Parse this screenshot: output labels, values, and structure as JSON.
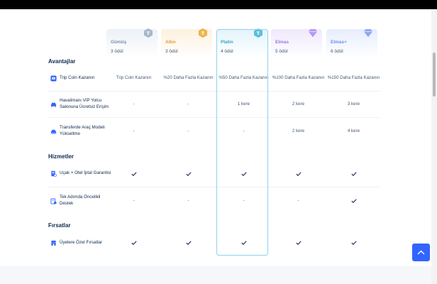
{
  "colors": {
    "accent": "#3264ff",
    "platin_border": "#8fd0ee",
    "text": "#0f294d",
    "muted": "#455873"
  },
  "tiers": [
    {
      "name": "Gümüş",
      "count": "3 ödül",
      "badge": "silver-badge-icon",
      "color": "#7c90a8"
    },
    {
      "name": "Altın",
      "count": "3 ödül",
      "badge": "gold-badge-icon",
      "color": "#e39a2c"
    },
    {
      "name": "Platin",
      "count": "4 ödül",
      "badge": "platinum-badge-icon",
      "color": "#34a6c7"
    },
    {
      "name": "Elmas",
      "count": "5 ödül",
      "badge": "diamond-badge-icon",
      "color": "#9a74ea"
    },
    {
      "name": "Elmas+",
      "count": "6 ödül",
      "badge": "diamond-plus-badge-icon",
      "color": "#6f8ff2"
    }
  ],
  "sections": {
    "advantages": "Avantajlar",
    "services": "Hizmetler",
    "deals": "Fırsatlar"
  },
  "rows": [
    {
      "label": "Trip Coin Kazanın",
      "icon": "trip-coin-icon",
      "cells": [
        "Trip Coin Kazanın",
        "%20 Daha Fazla Kazanın",
        "%50 Daha Fazla Kazanın",
        "%100 Daha Fazla Kazanın",
        "%150 Daha Fazla Kazanın"
      ]
    },
    {
      "label": "Havalimanı VIP Yolcu Salonuna Ücretsiz Erişim",
      "icon": "vip-lounge-icon",
      "cells": [
        "-",
        "-",
        "1 kere",
        "2 kere",
        "3 kere"
      ]
    },
    {
      "label": "Transferde Araç Modeli Yükseltme",
      "icon": "car-upgrade-icon",
      "cells": [
        "-",
        "-",
        "-",
        "2 kere",
        "4 kere"
      ]
    },
    {
      "label": "Uçak + Otel İptal Garantisi",
      "icon": "cancellation-guarantee-icon",
      "cells": [
        "check",
        "check",
        "check",
        "check",
        "check"
      ]
    },
    {
      "label": "Tek Adımda Öncelikli Destek",
      "icon": "priority-support-icon",
      "cells": [
        "-",
        "-",
        "-",
        "-",
        "check"
      ]
    },
    {
      "label": "Üyelere Özel Fırsatlar",
      "icon": "member-deals-icon",
      "cells": [
        "check",
        "check",
        "check",
        "check",
        "check"
      ]
    }
  ],
  "scroll_to_top_icon": "chevron-up-icon"
}
